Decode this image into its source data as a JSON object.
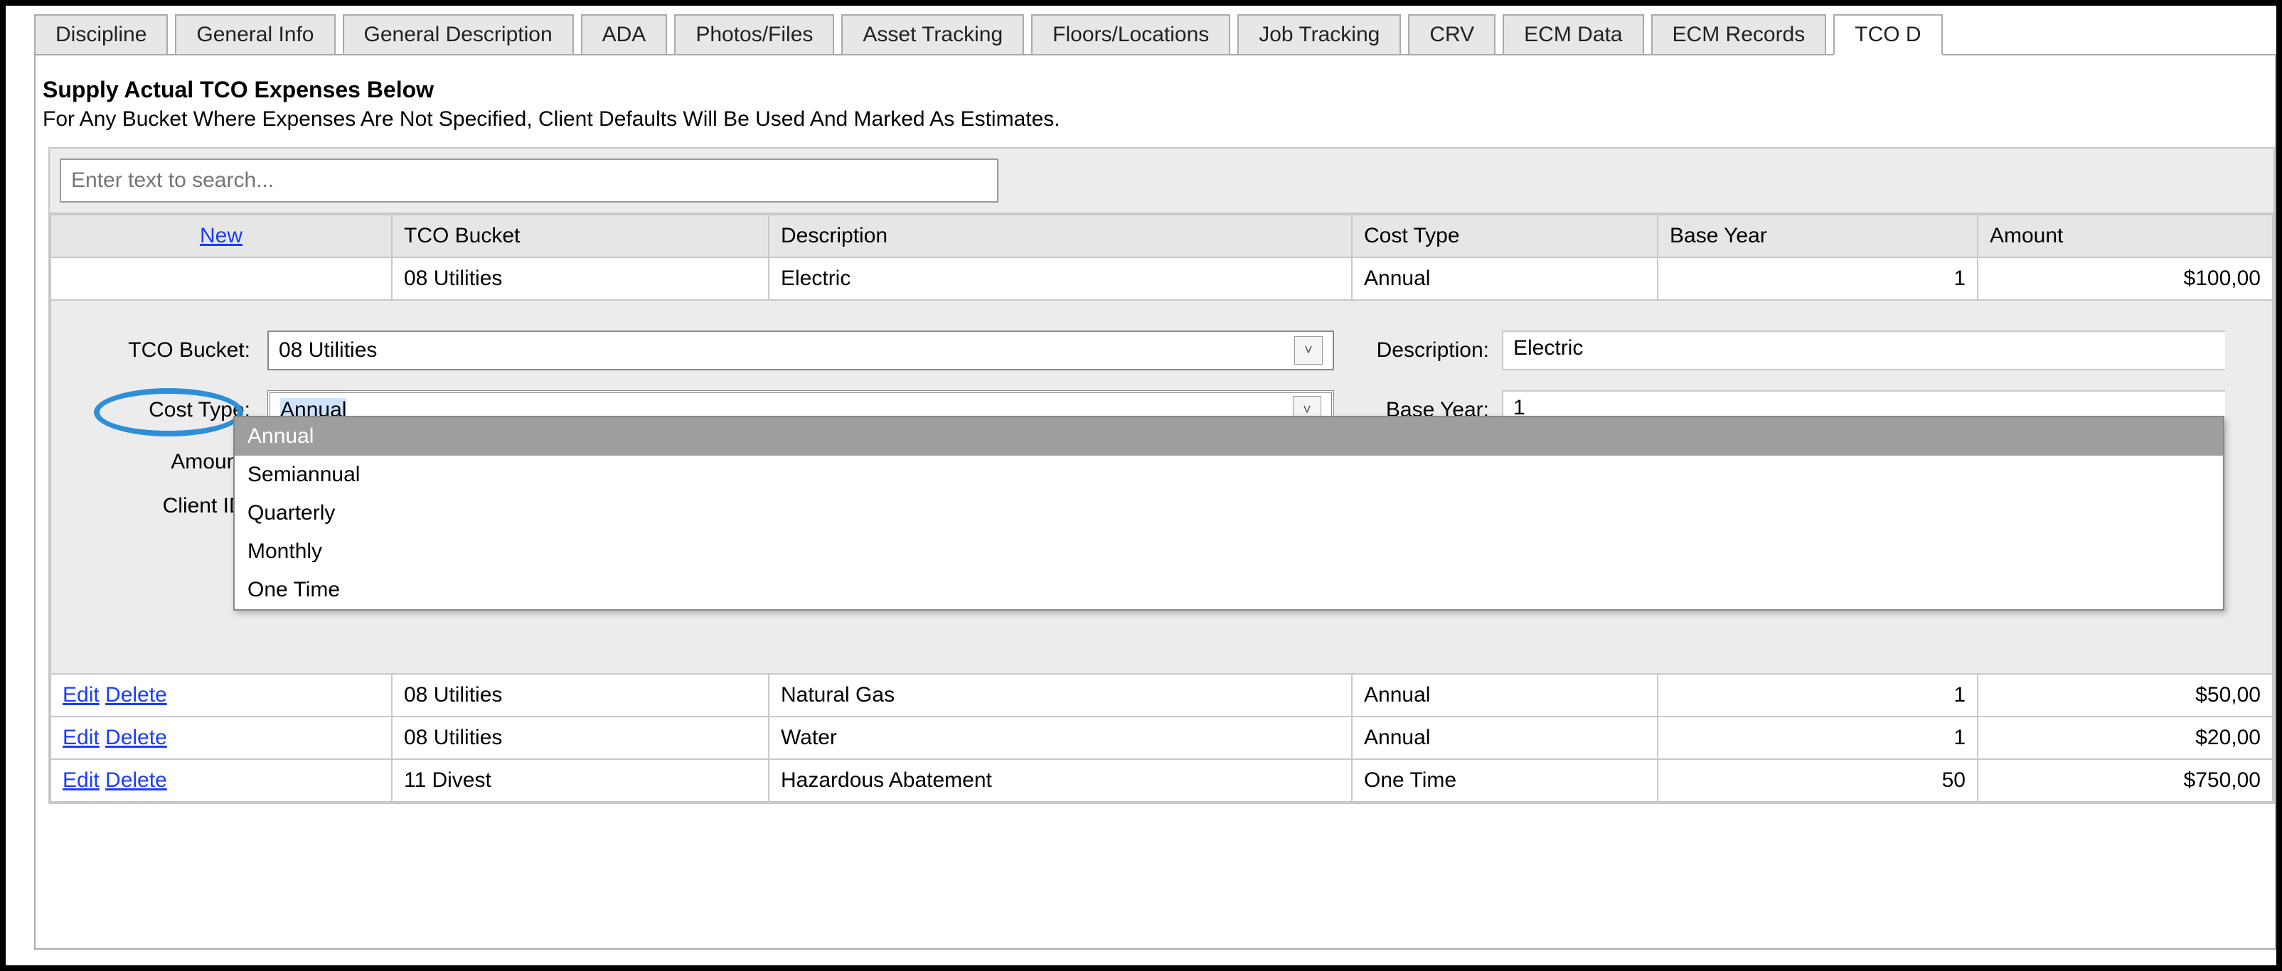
{
  "tabs": [
    "Discipline",
    "General Info",
    "General Description",
    "ADA",
    "Photos/Files",
    "Asset Tracking",
    "Floors/Locations",
    "Job Tracking",
    "CRV",
    "ECM Data",
    "ECM Records",
    "TCO D"
  ],
  "active_tab_index": 11,
  "header": {
    "title": "Supply Actual TCO Expenses Below",
    "subtitle": "For Any Bucket Where Expenses Are Not Specified, Client Defaults Will Be Used And Marked As Estimates."
  },
  "search": {
    "placeholder": "Enter text to search..."
  },
  "columns": {
    "new_link": "New",
    "bucket": "TCO Bucket",
    "description": "Description",
    "cost_type": "Cost Type",
    "base_year": "Base Year",
    "amount": "Amount"
  },
  "top_row": {
    "bucket": "08 Utilities",
    "description": "Electric",
    "cost_type": "Annual",
    "base_year": "1",
    "amount": "$100,00"
  },
  "edit_form": {
    "labels": {
      "tco_bucket": "TCO Bucket:",
      "cost_type": "Cost Type:",
      "amount": "Amount:",
      "client_id": "Client ID:",
      "description": "Description:",
      "base_year": "Base Year:"
    },
    "values": {
      "tco_bucket": "08 Utilities",
      "cost_type": "Annual",
      "description": "Electric",
      "base_year": "1"
    },
    "cost_type_options": [
      "Annual",
      "Semiannual",
      "Quarterly",
      "Monthly",
      "One Time"
    ],
    "cost_type_selected_index": 0
  },
  "rows": [
    {
      "edit": "Edit",
      "del": "Delete",
      "bucket": "08 Utilities",
      "description": "Natural Gas",
      "cost_type": "Annual",
      "base_year": "1",
      "amount": "$50,00"
    },
    {
      "edit": "Edit",
      "del": "Delete",
      "bucket": "08 Utilities",
      "description": "Water",
      "cost_type": "Annual",
      "base_year": "1",
      "amount": "$20,00"
    },
    {
      "edit": "Edit",
      "del": "Delete",
      "bucket": "11 Divest",
      "description": "Hazardous Abatement",
      "cost_type": "One Time",
      "base_year": "50",
      "amount": "$750,00"
    }
  ]
}
